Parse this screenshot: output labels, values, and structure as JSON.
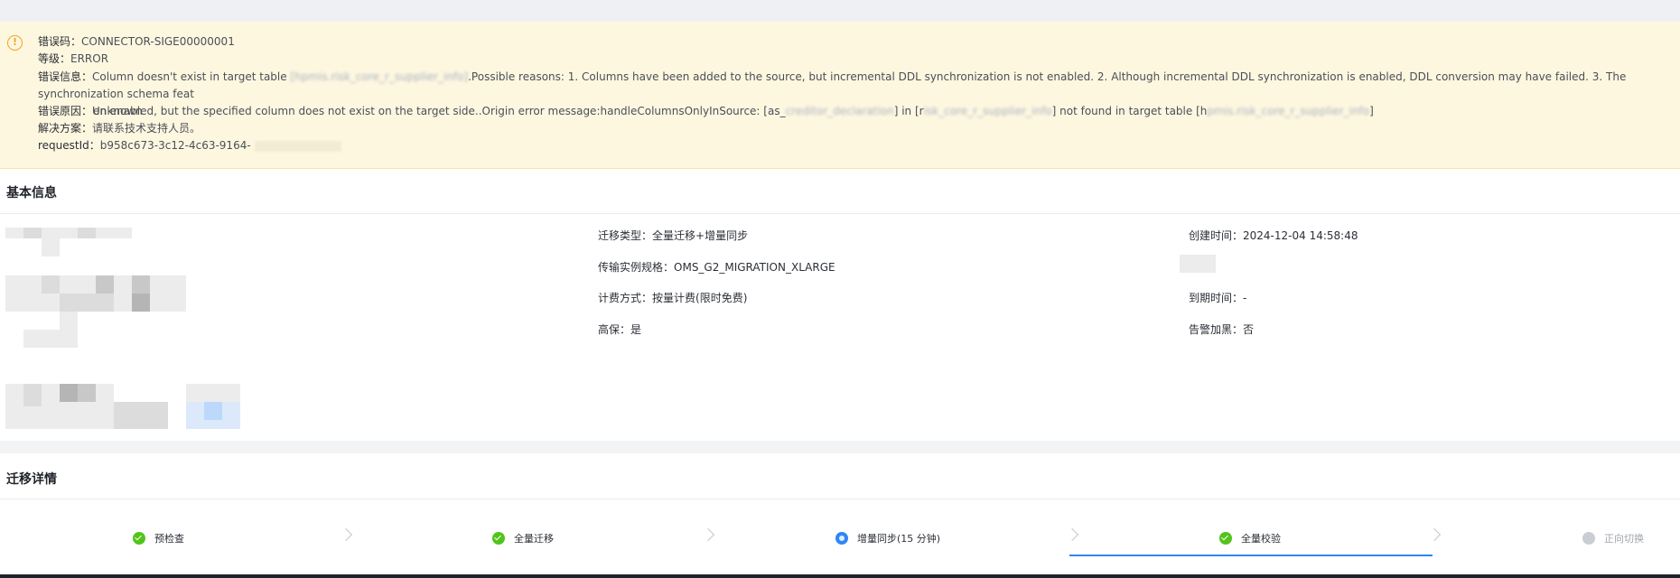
{
  "error": {
    "code_label": "错误码：",
    "code": "CONNECTOR-SIGE00000001",
    "level_label": "等级：",
    "level": "ERROR",
    "info_label": "错误信息：",
    "msg_part1": "Column doesn't exist in target table ",
    "msg_redact1": "[hpmis.risk_core_r_supplier_info]",
    "msg_part2": ".Possible reasons: 1. Columns have been added to the source, but incremental DDL synchronization is not enabled. 2. Although incremental DDL synchronization is enabled, DDL conversion may have failed. 3. The synchronization schema feat",
    "msg_line2_part1": "en enabled, but the specified column does not exist on the target side..Origin error message:handleColumnsOnlyInSource: [as_",
    "msg_redact2": "creditor_declaration",
    "msg_line2_part2": "] in [r",
    "msg_redact3": "isk_core_r_supplier_info",
    "msg_line2_part3": "] not found in target table [h",
    "msg_redact4": "pmis.risk_core_r_supplier_info",
    "msg_line2_part4": "]",
    "cause_label": "错误原因：",
    "cause": "Unknown",
    "solution_label": "解决方案：",
    "solution": "请联系技术支持人员。",
    "request_label": "requestId：",
    "request_id": "b958c673-3c12-4c63-9164-"
  },
  "basic_info": {
    "title": "基本信息",
    "migration_type_label": "迁移类型：",
    "migration_type": "全量迁移+增量同步",
    "spec_label": "传输实例规格：",
    "spec": "OMS_G2_MIGRATION_XLARGE",
    "billing_label": "计费方式：",
    "billing": "按量计费(限时免费)",
    "ha_label": "高保：",
    "ha": "是",
    "created_label": "创建时间：",
    "created": "2024-12-04 14:58:48",
    "expire_label": "到期时间：",
    "expire": "-",
    "alert_label": "告警加黑：",
    "alert": "否"
  },
  "details": {
    "title": "迁移详情",
    "steps": [
      {
        "label": "预检查",
        "status": "done"
      },
      {
        "label": "全量迁移",
        "status": "done"
      },
      {
        "label": "增量同步(15 分钟)",
        "status": "running"
      },
      {
        "label": "全量校验",
        "status": "done"
      },
      {
        "label": "正向切换",
        "status": "pending"
      }
    ]
  },
  "colors": {
    "warning": "#f3a423",
    "success": "#52c41a",
    "accent": "#2f86f6",
    "banner_bg": "#fef7e0"
  }
}
